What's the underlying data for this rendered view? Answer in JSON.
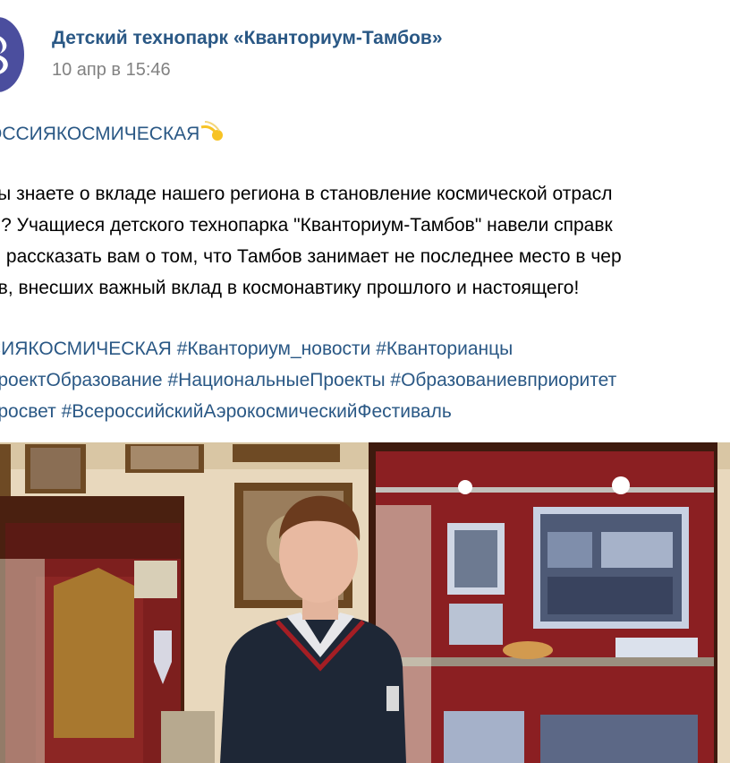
{
  "post": {
    "author": "Детский технопарк «Кванториум-Тамбов»",
    "date": "10 апр в 15:46"
  },
  "text": {
    "title_partial": "ОССИЯКОСМИЧЕСКАЯ",
    "title_emoji": "dizzy-emoji",
    "para_line1": "вы знаете о вкладе нашего региона в становление космической отрасл",
    "para_line2": "ы? Учащиеся детского технопарка \"Кванториум-Тамбов\" навели справк",
    "para_line3": "ы рассказать вам о том, что Тамбов занимает не последнее место в чер",
    "para_line4": "ов, внесших важный вклад в космонавтику прошлого и настоящего!"
  },
  "hashtags": {
    "line1": [
      "СИЯКОСМИЧЕСКАЯ",
      "#Кванториум_новости",
      "#Кванторианцы"
    ],
    "line2": [
      "проектОбразование",
      "#НациональныеПроекты",
      "#Образованиевприоритет"
    ],
    "line3": [
      "просвет",
      "#ВсероссийскийАэрокосмическийФестиваль"
    ]
  },
  "colors": {
    "link": "#2a5885",
    "meta": "#828282",
    "avatar": "#4b4e9e"
  },
  "media": {
    "kind": "video-preview",
    "icon": "video-thumbnail"
  }
}
